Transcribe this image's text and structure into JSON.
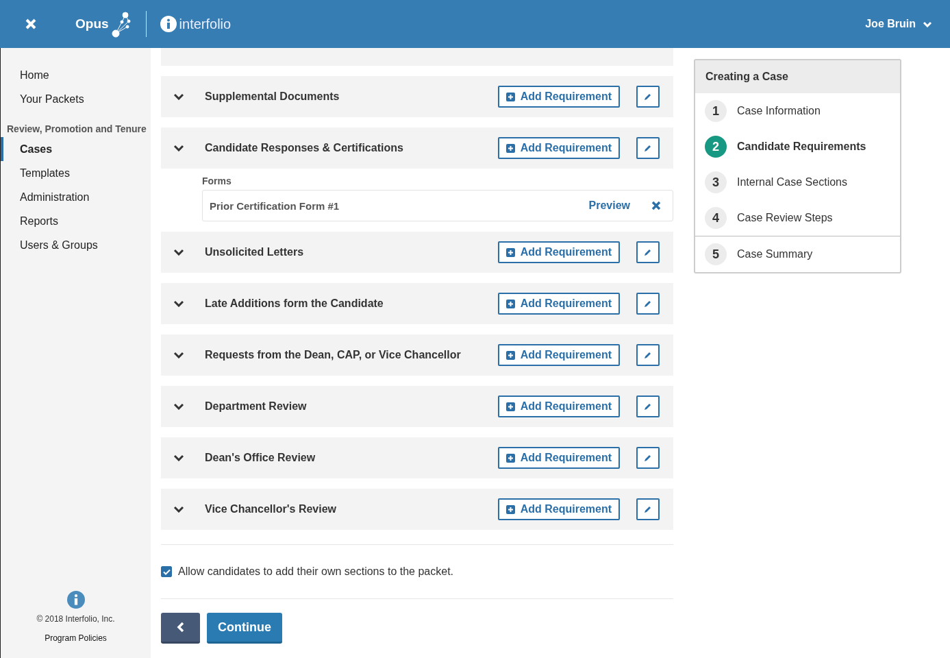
{
  "header": {
    "brand": "Opus",
    "partner": "interfolio",
    "user": "Joe Bruin"
  },
  "sidebar": {
    "items": [
      {
        "kind": "link",
        "label": "Home",
        "selected": false
      },
      {
        "kind": "link",
        "label": "Your Packets",
        "selected": false
      },
      {
        "kind": "heading",
        "label": "Review, Promotion and Tenure"
      },
      {
        "kind": "link",
        "label": "Cases",
        "selected": true
      },
      {
        "kind": "link",
        "label": "Templates",
        "selected": false
      },
      {
        "kind": "link",
        "label": "Administration",
        "selected": false
      },
      {
        "kind": "link",
        "label": "Reports",
        "selected": false
      },
      {
        "kind": "link",
        "label": "Users & Groups",
        "selected": false
      }
    ],
    "copyright": "© 2018 Interfolio, Inc.",
    "policies": "Program Policies"
  },
  "sections": [
    {
      "title": "Supplemental Documents",
      "add_label": "Add Requirement"
    },
    {
      "title": "Candidate Responses & Certifications",
      "add_label": "Add Requirement",
      "forms_label": "Forms",
      "forms": [
        {
          "name": "Prior Certification Form #1",
          "action": "Preview"
        }
      ]
    },
    {
      "title": "Unsolicited Letters",
      "add_label": "Add Requirement"
    },
    {
      "title": "Late Additions form the Candidate",
      "add_label": "Add Requirement"
    },
    {
      "title": "Requests from the Dean, CAP, or Vice Chancellor",
      "add_label": "Add Requirement"
    },
    {
      "title": "Department Review",
      "add_label": "Add Requirement"
    },
    {
      "title": "Dean's Office Review",
      "add_label": "Add Requirement"
    },
    {
      "title": "Vice Chancellor's Review",
      "add_label": "Add Requirement"
    }
  ],
  "allow_sections": {
    "label": "Allow candidates to add their own sections to the packet.",
    "checked": true
  },
  "continue_label": "Continue",
  "steps": {
    "title": "Creating a Case",
    "groups": [
      [
        {
          "number": "1",
          "label": "Case Information",
          "selected": false
        },
        {
          "number": "2",
          "label": "Candidate Requirements",
          "selected": true
        },
        {
          "number": "3",
          "label": "Internal Case Sections",
          "selected": false
        },
        {
          "number": "4",
          "label": "Case Review Steps",
          "selected": false
        }
      ],
      [
        {
          "number": "5",
          "label": "Case Summary",
          "selected": false
        }
      ]
    ]
  }
}
